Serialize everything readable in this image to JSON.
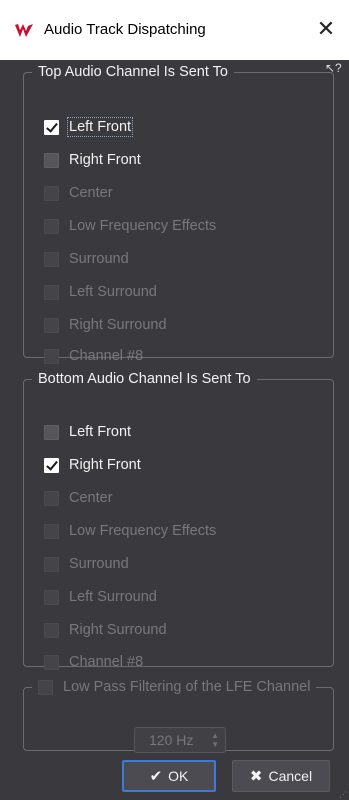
{
  "window": {
    "title": "Audio Track Dispatching",
    "close_glyph": "✕",
    "help_glyph": "↖?"
  },
  "top_group": {
    "title": "Top Audio Channel Is Sent To",
    "items": [
      {
        "label": "Left Front",
        "checked": true,
        "enabled": true
      },
      {
        "label": "Right Front",
        "checked": false,
        "enabled": true
      },
      {
        "label": "Center",
        "checked": false,
        "enabled": false
      },
      {
        "label": "Low Frequency Effects",
        "checked": false,
        "enabled": false
      },
      {
        "label": "Surround",
        "checked": false,
        "enabled": false
      },
      {
        "label": "Left Surround",
        "checked": false,
        "enabled": false
      },
      {
        "label": "Right Surround",
        "checked": false,
        "enabled": false
      },
      {
        "label": "Channel #8",
        "checked": false,
        "enabled": false
      }
    ]
  },
  "bottom_group": {
    "title": "Bottom Audio Channel Is Sent To",
    "items": [
      {
        "label": "Left Front",
        "checked": false,
        "enabled": true
      },
      {
        "label": "Right Front",
        "checked": true,
        "enabled": true
      },
      {
        "label": "Center",
        "checked": false,
        "enabled": false
      },
      {
        "label": "Low Frequency Effects",
        "checked": false,
        "enabled": false
      },
      {
        "label": "Surround",
        "checked": false,
        "enabled": false
      },
      {
        "label": "Left Surround",
        "checked": false,
        "enabled": false
      },
      {
        "label": "Right Surround",
        "checked": false,
        "enabled": false
      },
      {
        "label": "Channel #8",
        "checked": false,
        "enabled": false
      }
    ]
  },
  "lfe": {
    "label": "Low Pass Filtering of the LFE Channel",
    "checked": false,
    "enabled": false,
    "frequency": "120 Hz"
  },
  "buttons": {
    "ok_label": "OK",
    "ok_glyph": "✔",
    "cancel_label": "Cancel",
    "cancel_glyph": "✖"
  },
  "colors": {
    "background": "#3a3a3e",
    "titlebar": "#ffffff",
    "accent": "#3d7bd6",
    "app_icon": "#c8102e"
  }
}
